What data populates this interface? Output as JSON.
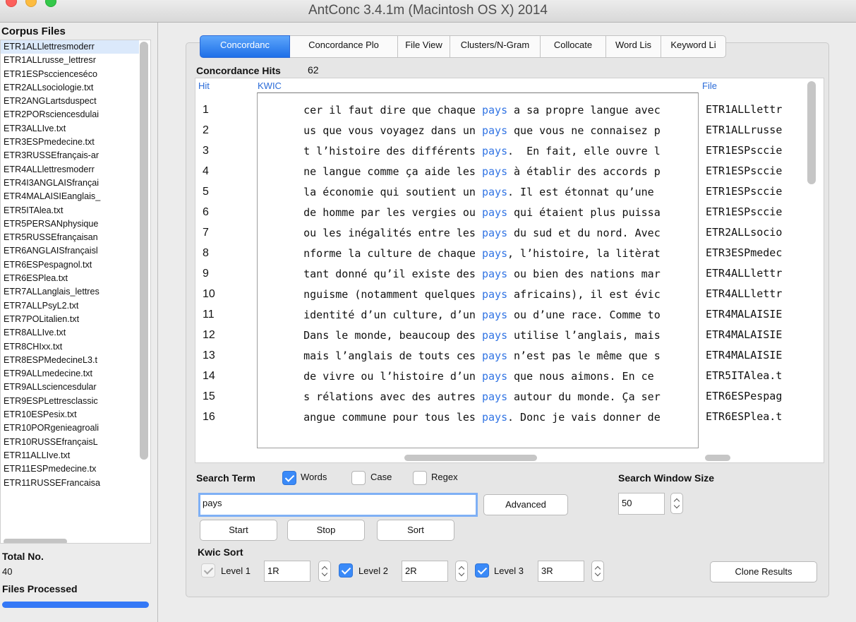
{
  "window": {
    "title": "AntConc 3.4.1m (Macintosh OS X) 2014"
  },
  "sidebar": {
    "corpus_label": "Corpus Files",
    "files": [
      "ETR1ALLlettresmoderr",
      "ETR1ALLrusse_lettresr",
      "ETR1ESPscciencesécо",
      "ETR2ALLsociologie.txt",
      "ETR2ANGLartsduspect",
      "ETR2PORsciencesdulai",
      "ETR3ALLIve.txt",
      "ETR3ESPmedecine.txt",
      "ETR3RUSSEfrançais-ar",
      "ETR4ALLlettresmoderr",
      "ETR4I3ANGLAISfrançai",
      "ETR4MALAISIEanglais_",
      "ETR5ITAlea.txt",
      "ETR5PERSANphysique",
      "ETR5RUSSEfrançaisan",
      "ETR6ANGLAISfrançaisl",
      "ETR6ESPespagnol.txt",
      "ETR6ESPlea.txt",
      "ETR7ALLanglais_lettres",
      "ETR7ALLPsyL2.txt",
      "ETR7POLitalien.txt",
      "ETR8ALLIve.txt",
      "ETR8CHIxx.txt",
      "ETR8ESPMedecineL3.t",
      "ETR9ALLmedecine.txt",
      "ETR9ALLsciencesdular",
      "ETR9ESPLettresclassic",
      "ETR10ESPesix.txt",
      "ETR10PORgenieagroali",
      "ETR10RUSSEfrançaisL",
      "ETR11ALLIve.txt",
      "ETR11ESPmedecine.tx",
      "ETR11RUSSEFrancaisa"
    ],
    "total_label": "Total No.",
    "total_value": "40",
    "processed_label": "Files Processed",
    "progress_fraction": 1.0
  },
  "tabs": [
    {
      "label": "Concordanc",
      "active": true
    },
    {
      "label": "Concordance Plo",
      "active": false
    },
    {
      "label": "File View",
      "active": false
    },
    {
      "label": "Clusters/N-Gram",
      "active": false
    },
    {
      "label": "Collocate",
      "active": false
    },
    {
      "label": "Word Lis",
      "active": false
    },
    {
      "label": "Keyword Li",
      "active": false
    }
  ],
  "concordance": {
    "hits_label": "Concordance Hits",
    "hits_count": "62",
    "col_hit": "Hit",
    "col_kwic": "KWIC",
    "col_file": "File",
    "rows": [
      {
        "hit": "1",
        "left": "cer il faut dire que chaque ",
        "node": "pays",
        "right": " a sa propre langue avec",
        "file": "ETR1ALLlettr"
      },
      {
        "hit": "2",
        "left": "us que vous voyagez dans un ",
        "node": "pays",
        "right": " que vous ne connaisez p",
        "file": "ETR1ALLrusse"
      },
      {
        "hit": "3",
        "left": "t l’histoire des différents ",
        "node": "pays",
        "right": ".  En fait, elle ouvre l",
        "file": "ETR1ESPsccie"
      },
      {
        "hit": "4",
        "left": "ne langue comme ça aide les ",
        "node": "pays",
        "right": " à établir des accords p",
        "file": "ETR1ESPsccie"
      },
      {
        "hit": "5",
        "left": "la économie qui soutient un ",
        "node": "pays",
        "right": ". Il est étonnat qu’une ",
        "file": "ETR1ESPsccie"
      },
      {
        "hit": "6",
        "left": "de homme par les vergies ou ",
        "node": "pays",
        "right": " qui étaient plus puissa",
        "file": "ETR1ESPsccie"
      },
      {
        "hit": "7",
        "left": "ou les inégalités entre les ",
        "node": "pays",
        "right": " du sud et du nord. Avec",
        "file": "ETR2ALLsocio"
      },
      {
        "hit": "8",
        "left": "nforme la culture de chaque ",
        "node": "pays",
        "right": ", l’histoire, la litèrat",
        "file": "ETR3ESPmedec"
      },
      {
        "hit": "9",
        "left": "tant donné qu’il existe des ",
        "node": "pays",
        "right": " ou bien des nations mar",
        "file": "ETR4ALLlettr"
      },
      {
        "hit": "10",
        "left": "nguisme (notamment quelques ",
        "node": "pays",
        "right": " africains), il est évic",
        "file": "ETR4ALLlettr"
      },
      {
        "hit": "11",
        "left": "identité d’un culture, d’un ",
        "node": "pays",
        "right": " ou d’une race. Comme to",
        "file": "ETR4MALAISIE"
      },
      {
        "hit": "12",
        "left": "Dans le monde, beaucoup des ",
        "node": "pays",
        "right": " utilise l’anglais, mais",
        "file": "ETR4MALAISIE"
      },
      {
        "hit": "13",
        "left": "mais l’anglais de touts ces ",
        "node": "pays",
        "right": " n’est pas le même que s",
        "file": "ETR4MALAISIE"
      },
      {
        "hit": "14",
        "left": "de vivre ou l’histoire d’un ",
        "node": "pays",
        "right": " que nous aimons. En ce ",
        "file": "ETR5ITAlea.t"
      },
      {
        "hit": "15",
        "left": "s rélations avec des autres ",
        "node": "pays",
        "right": " autour du monde. Ça ser",
        "file": "ETR6ESPespag"
      },
      {
        "hit": "16",
        "left": "angue commune pour tous les ",
        "node": "pays",
        "right": ". Donc je vais donner de",
        "file": "ETR6ESPlea.t"
      }
    ]
  },
  "search": {
    "term_label": "Search Term",
    "words_label": "Words",
    "words_checked": true,
    "case_label": "Case",
    "case_checked": false,
    "regex_label": "Regex",
    "regex_checked": false,
    "term_value": "pays",
    "advanced_label": "Advanced",
    "window_size_label": "Search Window Size",
    "window_size_value": "50",
    "start_label": "Start",
    "stop_label": "Stop",
    "sort_label": "Sort"
  },
  "kwic_sort": {
    "label": "Kwic Sort",
    "level1_label": "Level 1",
    "level1_value": "1R",
    "level2_label": "Level 2",
    "level2_value": "2R",
    "level3_label": "Level 3",
    "level3_value": "3R",
    "clone_label": "Clone Results"
  },
  "colors": {
    "accent": "#3478f6",
    "kwic_node": "#3174e4"
  }
}
